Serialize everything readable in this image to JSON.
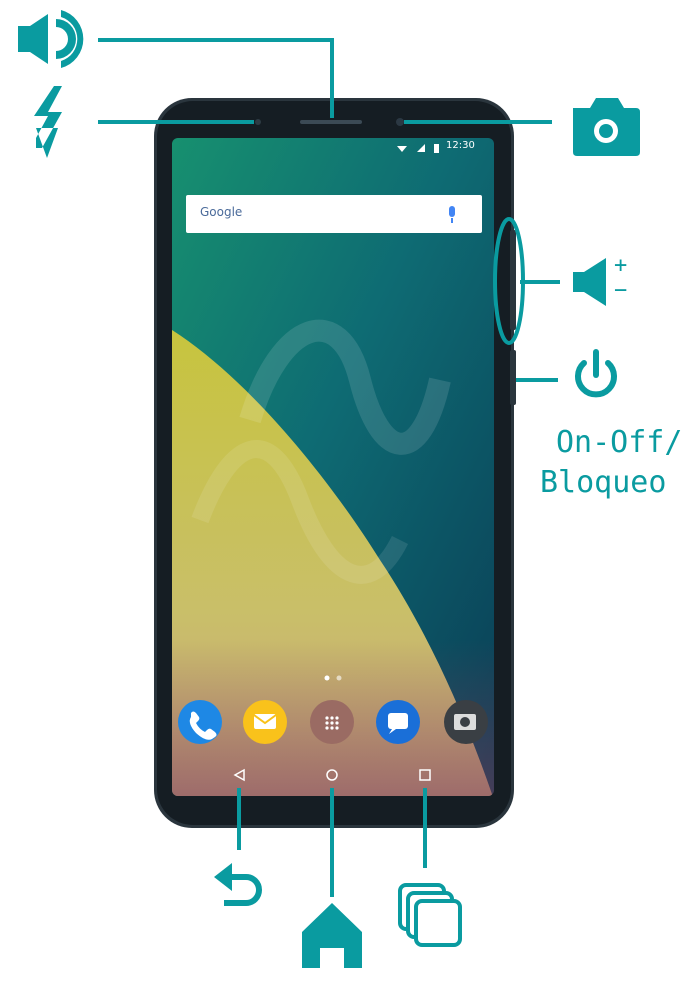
{
  "status_bar": {
    "time": "12:30"
  },
  "search_widget": {
    "logo_text": "Google"
  },
  "labels": {
    "power_line1": "On-Off/",
    "power_line2": "Bloqueo"
  },
  "volume_signs": {
    "plus": "+",
    "minus": "−"
  },
  "colors": {
    "accent": "#0a9ba0",
    "phone_frame": "#1f2b33",
    "screen_top": "#0d7a6a",
    "wallpaper_yellow": "#c9c34a"
  },
  "icons": [
    "speaker-icon",
    "flash-icon",
    "camera-icon",
    "volume-icon",
    "power-icon",
    "back-icon",
    "home-icon",
    "recents-icon"
  ]
}
